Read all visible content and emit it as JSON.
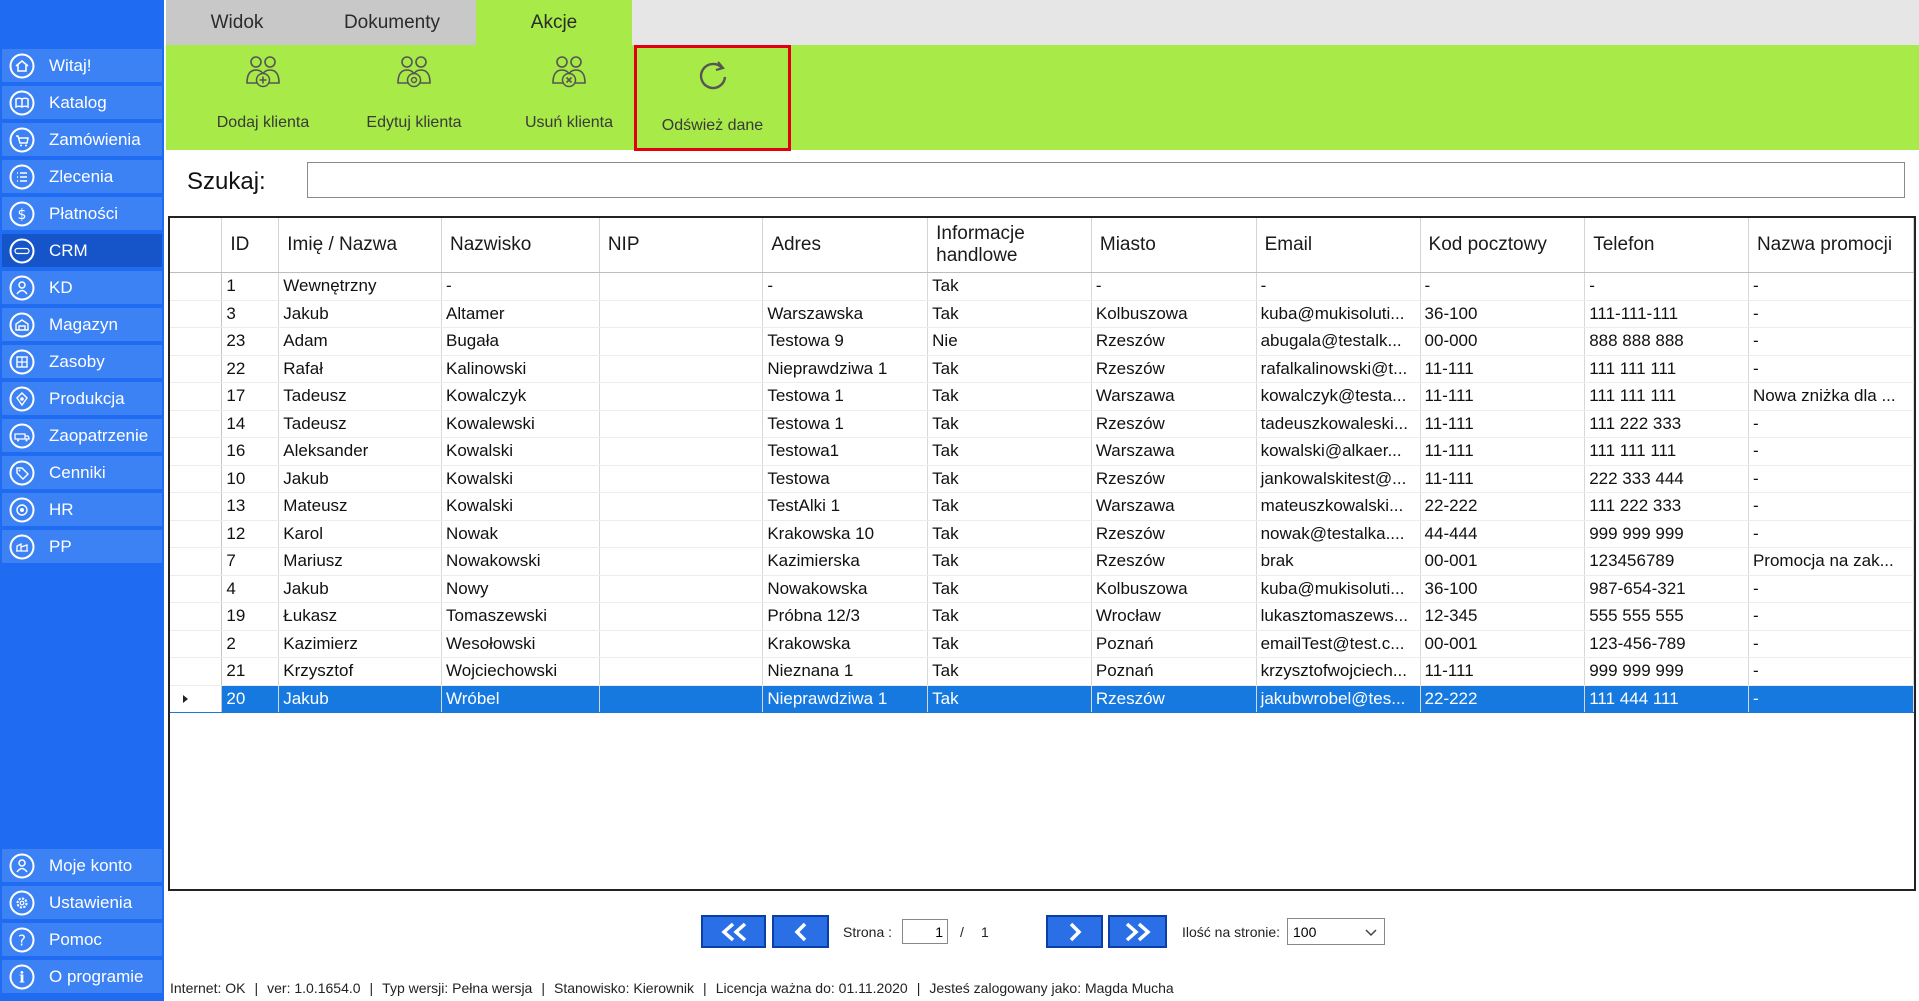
{
  "sidebar": {
    "items": [
      {
        "label": "Witaj!",
        "icon": "home-icon"
      },
      {
        "label": "Katalog",
        "icon": "book-icon"
      },
      {
        "label": "Zamówienia",
        "icon": "cart-icon"
      },
      {
        "label": "Zlecenia",
        "icon": "list-icon"
      },
      {
        "label": "Płatności",
        "icon": "dollar-icon"
      },
      {
        "label": "CRM",
        "icon": "crm-icon"
      },
      {
        "label": "KD",
        "icon": "person-icon"
      },
      {
        "label": "Magazyn",
        "icon": "warehouse-icon"
      },
      {
        "label": "Zasoby",
        "icon": "boxes-icon"
      },
      {
        "label": "Produkcja",
        "icon": "production-icon"
      },
      {
        "label": "Zaopatrzenie",
        "icon": "supply-icon"
      },
      {
        "label": "Cenniki",
        "icon": "tag-icon"
      },
      {
        "label": "HR",
        "icon": "hr-icon"
      },
      {
        "label": "PP",
        "icon": "pp-icon"
      }
    ],
    "bottom_items": [
      {
        "label": "Moje konto",
        "icon": "account-icon"
      },
      {
        "label": "Ustawienia",
        "icon": "gear-icon"
      },
      {
        "label": "Pomoc",
        "icon": "help-icon"
      },
      {
        "label": "O programie",
        "icon": "info-icon"
      }
    ],
    "active": "CRM"
  },
  "tabs": {
    "widok": "Widok",
    "dokumenty": "Dokumenty",
    "akcje": "Akcje",
    "active": "Akcje"
  },
  "ribbon": {
    "add": "Dodaj klienta",
    "edit": "Edytuj klienta",
    "delete": "Usuń klienta",
    "refresh": "Odśwież dane"
  },
  "search": {
    "label": "Szukaj:",
    "value": ""
  },
  "table": {
    "columns": [
      "ID",
      "Imię / Nazwa",
      "Nazwisko",
      "NIP",
      "Adres",
      "Informacje handlowe",
      "Miasto",
      "Email",
      "Kod pocztowy",
      "Telefon",
      "Nazwa promocji"
    ],
    "rows": [
      [
        "1",
        "Wewnętrzny",
        "-",
        "",
        "-",
        "Tak",
        "-",
        "-",
        "-",
        "-",
        "-"
      ],
      [
        "3",
        "Jakub",
        "Altamer",
        "",
        "Warszawska",
        "Tak",
        "Kolbuszowa",
        "kuba@mukisoluti...",
        "36-100",
        "111-111-111",
        "-"
      ],
      [
        "23",
        "Adam",
        "Bugała",
        "",
        "Testowa 9",
        "Nie",
        "Rzeszów",
        "abugala@testalk...",
        "00-000",
        "888 888 888",
        "-"
      ],
      [
        "22",
        "Rafał",
        "Kalinowski",
        "",
        "Nieprawdziwa 1",
        "Tak",
        "Rzeszów",
        "rafalkalinowski@t...",
        "11-111",
        "111 111 111",
        "-"
      ],
      [
        "17",
        "Tadeusz",
        "Kowalczyk",
        "",
        "Testowa 1",
        "Tak",
        "Warszawa",
        "kowalczyk@testa...",
        "11-111",
        "111 111 111",
        "Nowa zniżka dla ..."
      ],
      [
        "14",
        "Tadeusz",
        "Kowalewski",
        "",
        "Testowa 1",
        "Tak",
        "Rzeszów",
        "tadeuszkowaleski...",
        "11-111",
        "111 222 333",
        "-"
      ],
      [
        "16",
        "Aleksander",
        "Kowalski",
        "",
        "Testowa1",
        "Tak",
        "Warszawa",
        "kowalski@alkaer...",
        "11-111",
        "111 111 111",
        "-"
      ],
      [
        "10",
        "Jakub",
        "Kowalski",
        "",
        "Testowa",
        "Tak",
        "Rzeszów",
        "jankowalskitest@...",
        "11-111",
        "222 333 444",
        "-"
      ],
      [
        "13",
        "Mateusz",
        "Kowalski",
        "",
        "TestAlki 1",
        "Tak",
        "Warszawa",
        "mateuszkowalski...",
        "22-222",
        "111 222 333",
        "-"
      ],
      [
        "12",
        "Karol",
        "Nowak",
        "",
        "Krakowska 10",
        "Tak",
        "Rzeszów",
        "nowak@testalka....",
        "44-444",
        "999 999 999",
        "-"
      ],
      [
        "7",
        "Mariusz",
        "Nowakowski",
        "",
        "Kazimierska",
        "Tak",
        "Rzeszów",
        "brak",
        "00-001",
        "123456789",
        "Promocja na zak..."
      ],
      [
        "4",
        "Jakub",
        "Nowy",
        "",
        "Nowakowska",
        "Tak",
        "Kolbuszowa",
        "kuba@mukisoluti...",
        "36-100",
        "987-654-321",
        "-"
      ],
      [
        "19",
        "Łukasz",
        "Tomaszewski",
        "",
        "Próbna 12/3",
        "Tak",
        "Wrocław",
        "lukasztomaszews...",
        "12-345",
        "555 555 555",
        "-"
      ],
      [
        "2",
        "Kazimierz",
        "Wesołowski",
        "",
        "Krakowska",
        "Tak",
        "Poznań",
        "emailTest@test.c...",
        "00-001",
        "123-456-789",
        "-"
      ],
      [
        "21",
        "Krzysztof",
        "Wojciechowski",
        "",
        "Nieznana 1",
        "Tak",
        "Poznań",
        "krzysztofwojciech...",
        "11-111",
        "999 999 999",
        "-"
      ],
      [
        "20",
        "Jakub",
        "Wróbel",
        "",
        "Nieprawdziwa 1",
        "Tak",
        "Rzeszów",
        "jakubwrobel@tes...",
        "22-222",
        "111 444 111",
        "-"
      ]
    ],
    "selected_index": 15
  },
  "pager": {
    "page_label": "Strona :",
    "current_page": "1",
    "separator": "/",
    "total_pages": "1",
    "per_page_label": "Ilość na stronie:",
    "per_page_value": "100"
  },
  "status": {
    "internet": "Internet: OK",
    "version": "ver: 1.0.1654.0",
    "edition": "Typ wersji: Pełna wersja",
    "position": "Stanowisko: Kierownik",
    "license": "Licencja ważna do: 01.11.2020",
    "user": "Jesteś zalogowany jako: Magda Mucha"
  },
  "colors": {
    "sidebar": "#1f6cf2",
    "ribbon": "#a8ea47",
    "selection": "#1579e0",
    "highlight": "#e0000f"
  }
}
